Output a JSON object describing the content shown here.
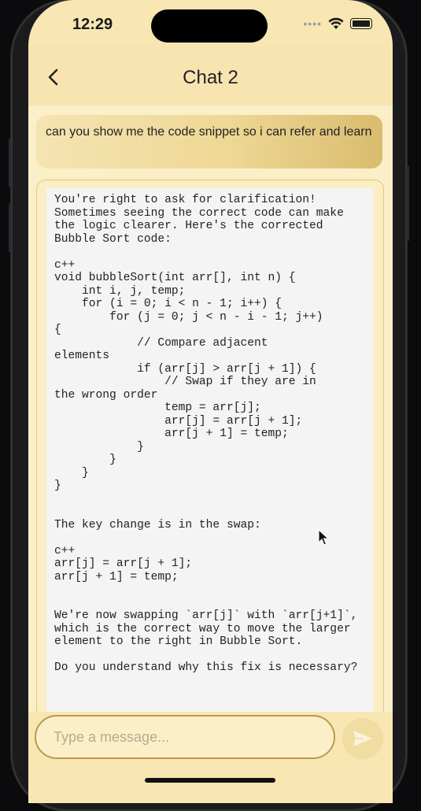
{
  "status_bar": {
    "time": "12:29"
  },
  "header": {
    "title": "Chat 2"
  },
  "messages": {
    "user": "can you show me the code snippet so i can refer and learn",
    "bot": "You're right to ask for clarification! Sometimes seeing the correct code can make the logic clearer. Here's the corrected Bubble Sort code:\n\nc++\nvoid bubbleSort(int arr[], int n) {\n    int i, j, temp;\n    for (i = 0; i < n - 1; i++) {\n        for (j = 0; j < n - i - 1; j++)\n{\n            // Compare adjacent\nelements\n            if (arr[j] > arr[j + 1]) {\n                // Swap if they are in\nthe wrong order\n                temp = arr[j];\n                arr[j] = arr[j + 1];\n                arr[j + 1] = temp;\n            }\n        }\n    }\n}\n\n\nThe key change is in the swap:\n\nc++\narr[j] = arr[j + 1];\narr[j + 1] = temp;\n\n\nWe're now swapping `arr[j]` with `arr[j+1]`, which is the correct way to move the larger element to the right in Bubble Sort.\n\nDo you understand why this fix is necessary?"
  },
  "input": {
    "placeholder": "Type a message...",
    "value": ""
  },
  "icons": {
    "back": "chevron-left-icon",
    "send": "send-icon",
    "wifi": "wifi-icon",
    "battery": "battery-icon",
    "cursor": "mouse-cursor-icon"
  },
  "colors": {
    "background": "#f8e6b3",
    "chat_background": "#fbefc8",
    "user_bubble_start": "#f5e4b2",
    "user_bubble_end": "#d9bc6e",
    "code_background": "#f4f4f4",
    "input_border": "#b69a52",
    "send_button": "#f1dda1"
  }
}
